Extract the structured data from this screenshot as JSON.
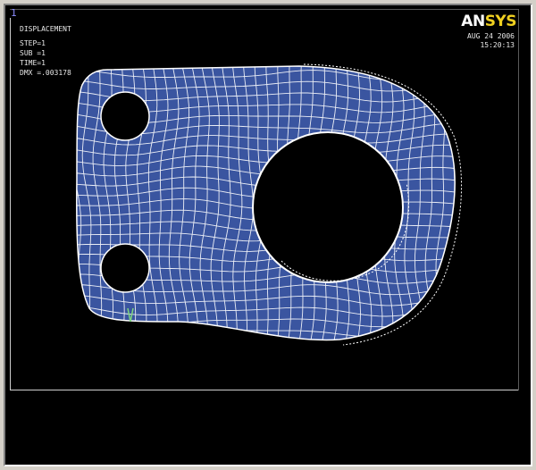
{
  "window": {
    "number": "1"
  },
  "legend": {
    "title": "DISPLACEMENT",
    "step": "STEP=1",
    "sub": "SUB =1",
    "time": "TIME=1",
    "dmx": "DMX =.003178"
  },
  "brand": {
    "logo_main": "AN",
    "logo_accent": "SYS"
  },
  "timestamp": {
    "date": "AUG 24 2006",
    "time": "15:20:13"
  },
  "colors": {
    "background": "#000000",
    "part_fill": "#3a55a0",
    "mesh_lines": "#ffffff",
    "undeformed_edge": "#ffffff",
    "constraint_marker": "#7ed67e",
    "logo_accent": "#f0d020"
  }
}
